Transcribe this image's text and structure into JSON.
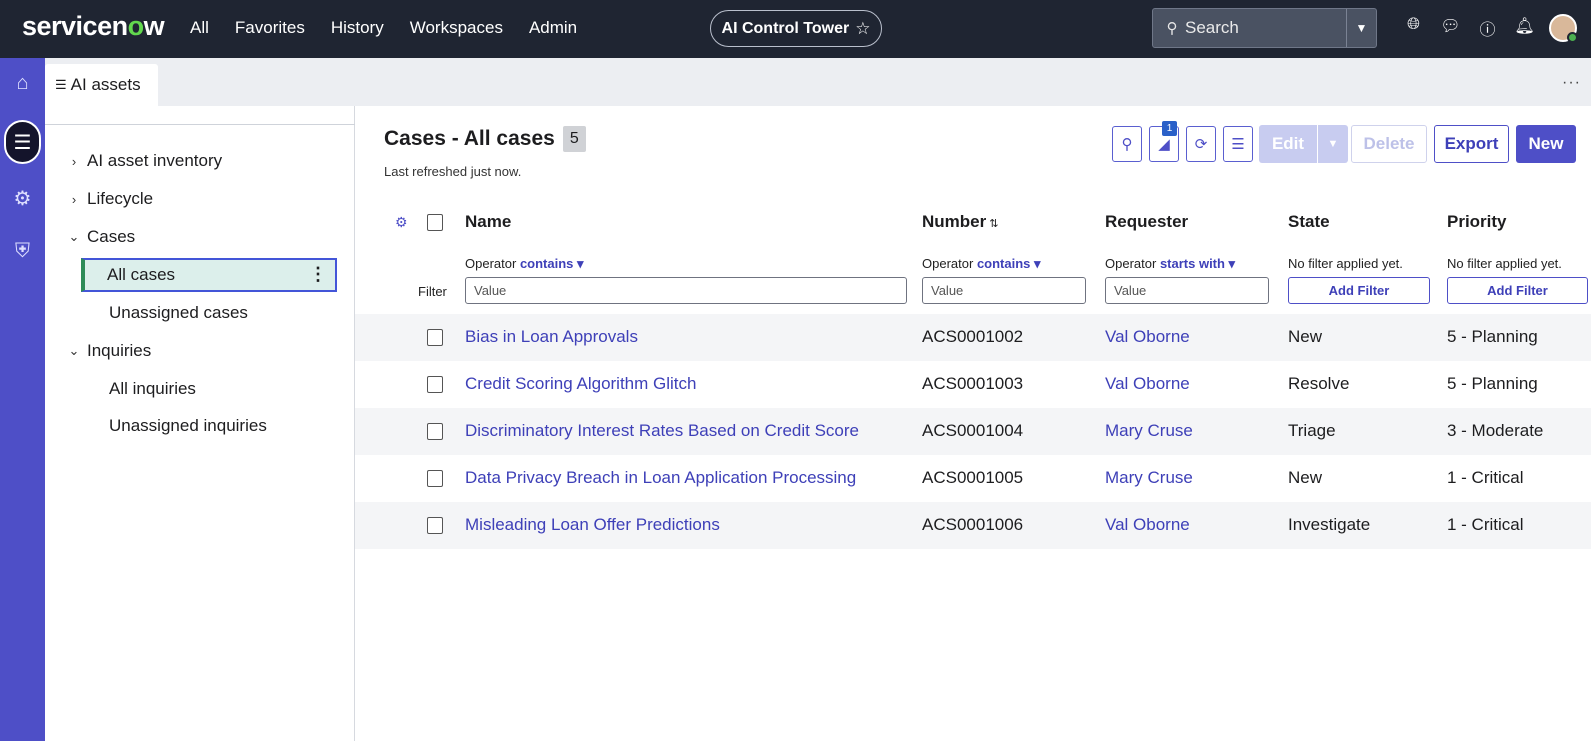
{
  "brand": {
    "logo_pre": "servicen",
    "logo_o": "o",
    "logo_post": "w"
  },
  "nav": [
    "All",
    "Favorites",
    "History",
    "Workspaces",
    "Admin"
  ],
  "workspace_pill": {
    "label": "AI Control Tower",
    "star": "☆"
  },
  "search": {
    "placeholder": "Search"
  },
  "top_icons": [
    "globe-icon",
    "chat-icon",
    "help-icon",
    "bell-icon"
  ],
  "tab": {
    "label": "AI assets"
  },
  "sidebar": {
    "items": [
      {
        "label": "AI asset inventory",
        "chevron": "›"
      },
      {
        "label": "Lifecycle",
        "chevron": "›"
      },
      {
        "label": "Cases",
        "chevron": "⌄"
      },
      {
        "label": "Inquiries",
        "chevron": "⌄"
      }
    ],
    "cases_children": [
      "All cases",
      "Unassigned cases"
    ],
    "inquiries_children": [
      "All inquiries",
      "Unassigned inquiries"
    ]
  },
  "list": {
    "title": "Cases - All cases",
    "count": "5",
    "refreshed": "Last refreshed just now.",
    "filter_badge": "1",
    "buttons": {
      "edit": "Edit",
      "delete": "Delete",
      "export": "Export",
      "new": "New"
    },
    "columns": {
      "name": "Name",
      "number": "Number",
      "requester": "Requester",
      "state": "State",
      "priority": "Priority"
    },
    "operator_label": "Operator",
    "operators": {
      "name": "contains ▾",
      "number": "contains ▾",
      "requester": "starts with ▾"
    },
    "no_filter": "No filter applied yet.",
    "add_filter": "Add Filter",
    "filter_label": "Filter",
    "value_placeholder": "Value",
    "rows": [
      {
        "name": "Bias in Loan Approvals",
        "number": "ACS0001002",
        "requester": "Val Oborne",
        "state": "New",
        "priority": "5 - Planning"
      },
      {
        "name": "Credit Scoring Algorithm Glitch",
        "number": "ACS0001003",
        "requester": "Val Oborne",
        "state": "Resolve",
        "priority": "5 - Planning"
      },
      {
        "name": "Discriminatory Interest Rates Based on Credit Score",
        "number": "ACS0001004",
        "requester": "Mary Cruse",
        "state": "Triage",
        "priority": "3 - Moderate"
      },
      {
        "name": "Data Privacy Breach in Loan Application Processing",
        "number": "ACS0001005",
        "requester": "Mary Cruse",
        "state": "New",
        "priority": "1 - Critical"
      },
      {
        "name": "Misleading Loan Offer Predictions",
        "number": "ACS0001006",
        "requester": "Val Oborne",
        "state": "Investigate",
        "priority": "1 - Critical"
      }
    ]
  },
  "colors": {
    "topbar": "#1f2532",
    "accent": "#4e4fc7",
    "link": "#3e40b8",
    "selected_bg": "#dcefeb"
  }
}
